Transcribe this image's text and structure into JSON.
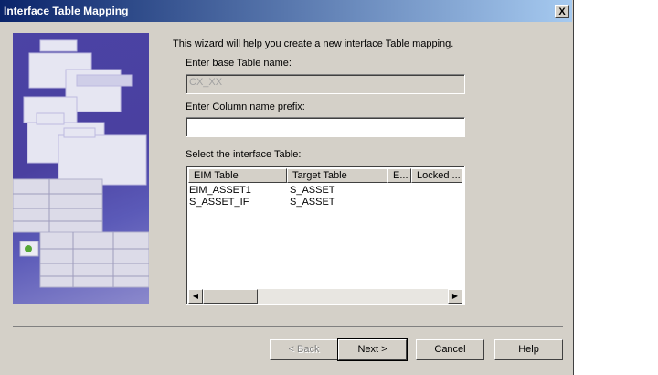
{
  "window": {
    "title": "Interface Table Mapping",
    "close_label": "X"
  },
  "wizard": {
    "intro": "This wizard will help you create a new interface Table mapping.",
    "base_table_label": "Enter base Table name:",
    "base_table_value": "CX_XX",
    "column_prefix_label": "Enter Column name prefix:",
    "column_prefix_value": "",
    "select_table_label": "Select the interface Table:"
  },
  "table": {
    "columns": [
      "EIM Table",
      "Target Table",
      "E...",
      "Locked ..."
    ],
    "rows": [
      [
        "EIM_ASSET1",
        "S_ASSET",
        "",
        ""
      ],
      [
        "S_ASSET_IF",
        "S_ASSET",
        "",
        ""
      ]
    ]
  },
  "buttons": {
    "back": "< Back",
    "next": "Next >",
    "cancel": "Cancel",
    "help": "Help"
  },
  "scroll": {
    "left_arrow": "◀",
    "right_arrow": "▶"
  }
}
